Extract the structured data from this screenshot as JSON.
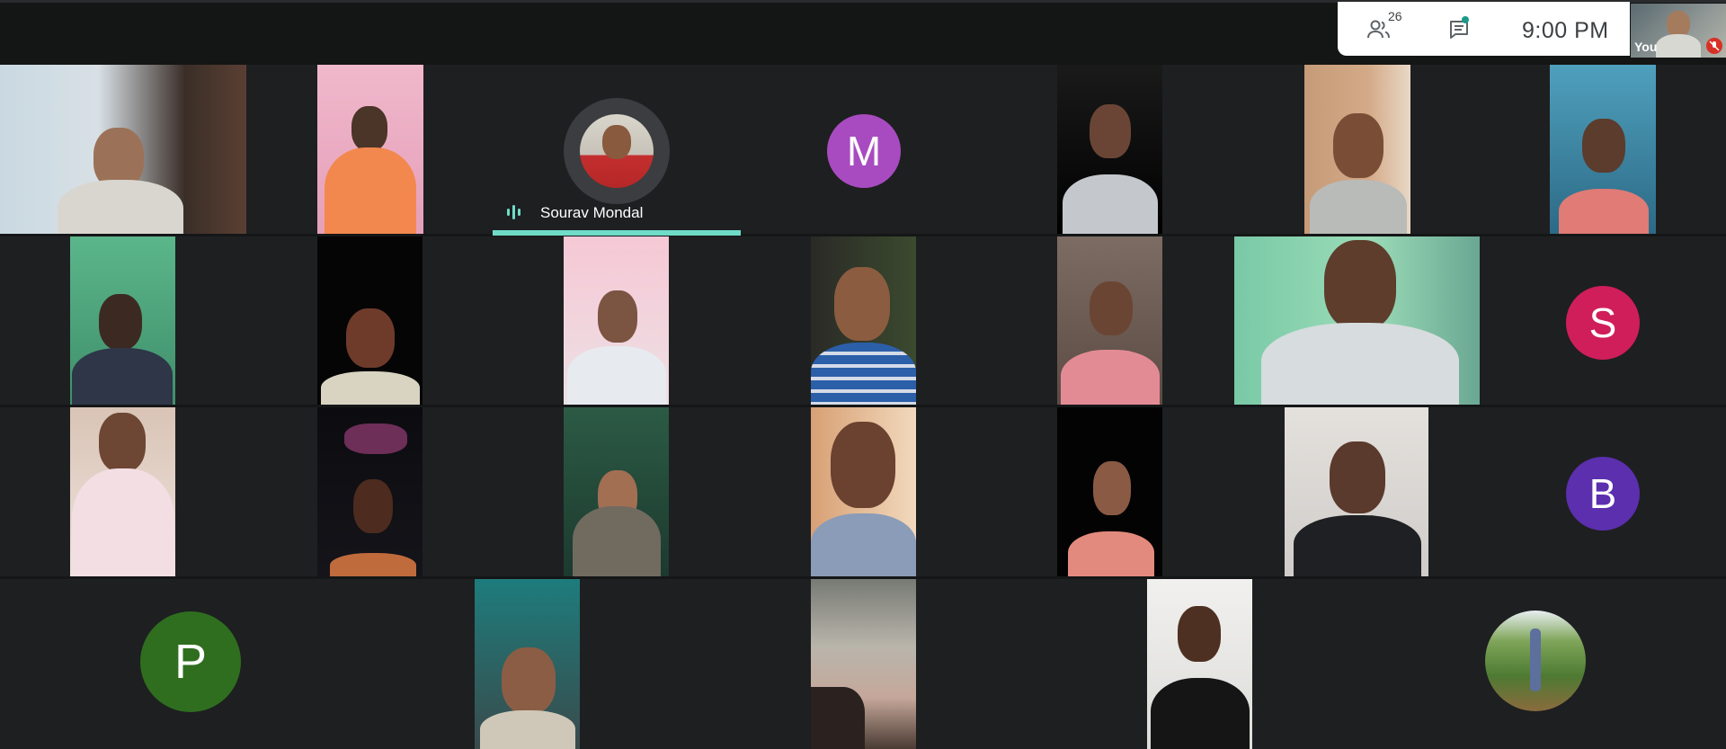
{
  "meeting": {
    "participant_count": "26",
    "time": "9:00  PM",
    "self_label": "You",
    "active_speaker": "Sourav Mondal"
  },
  "avatars": {
    "m": "M",
    "s": "S",
    "b": "B",
    "p": "P"
  },
  "colors": {
    "background": "#151617",
    "tile": "#1e1f21",
    "speaker_accent": "#6fdcc7",
    "avatar_m": "#a84bc0",
    "avatar_s": "#d01e5b",
    "avatar_b": "#5b2fad",
    "avatar_p": "#2f6e1f",
    "mute": "#d93025"
  },
  "icons": [
    "people-icon",
    "chat-icon",
    "mic-off-icon",
    "audio-level-icon"
  ]
}
